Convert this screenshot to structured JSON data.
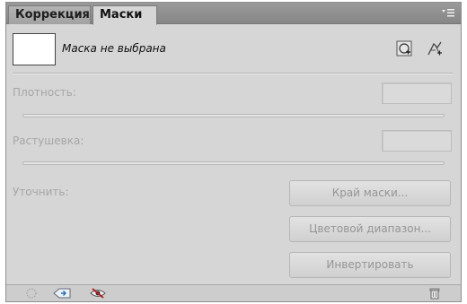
{
  "tabs": [
    {
      "label": "Коррекция",
      "active": false
    },
    {
      "label": "Маски",
      "active": true
    }
  ],
  "panel_menu_icon": "panel-menu-icon",
  "mask": {
    "label": "Маска не выбрана",
    "pixel_mask_icon": "add-pixel-mask-icon",
    "vector_mask_icon": "add-vector-mask-icon"
  },
  "density": {
    "label": "Плотность:",
    "value": ""
  },
  "feather": {
    "label": "Растушевка:",
    "value": ""
  },
  "refine": {
    "label": "Уточнить:",
    "mask_edge_label": "Край маски...",
    "color_range_label": "Цветовой диапазон...",
    "invert_label": "Инвертировать"
  },
  "bottom_icons": [
    "load-selection-icon",
    "apply-mask-icon",
    "toggle-visibility-icon",
    "delete-mask-icon"
  ],
  "colors": {
    "panel_bg": "#d6d6d6",
    "tabbar_bg": "#8e8e8e",
    "disabled_text": "#a6a6a6"
  }
}
